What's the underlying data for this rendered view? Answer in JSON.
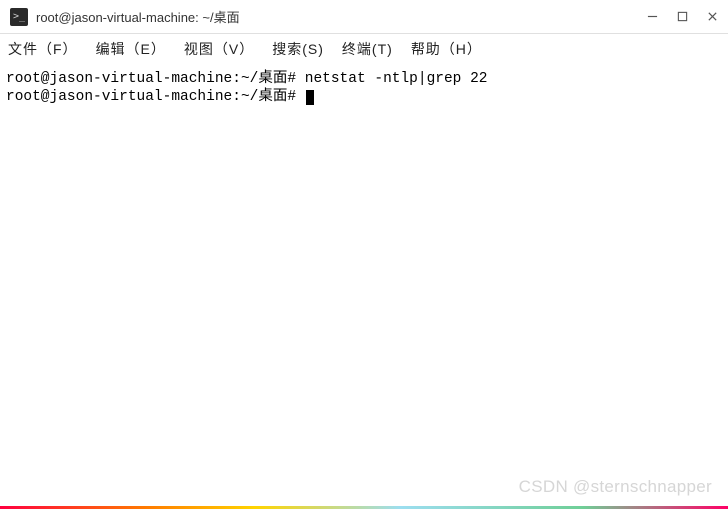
{
  "titlebar": {
    "icon_glyph": ">_",
    "title": "root@jason-virtual-machine: ~/桌面"
  },
  "menubar": {
    "file": "文件（F）",
    "edit": "编辑（E）",
    "view": "视图（V）",
    "search": "搜索(S)",
    "terminal": "终端(T)",
    "help": "帮助（H）"
  },
  "terminal": {
    "lines": [
      {
        "prompt": "root@jason-virtual-machine:~/桌面#",
        "command": "netstat -ntlp|grep 22"
      },
      {
        "prompt": "root@jason-virtual-machine:~/桌面#",
        "command": ""
      }
    ]
  },
  "watermark": "CSDN @sternschnapper"
}
